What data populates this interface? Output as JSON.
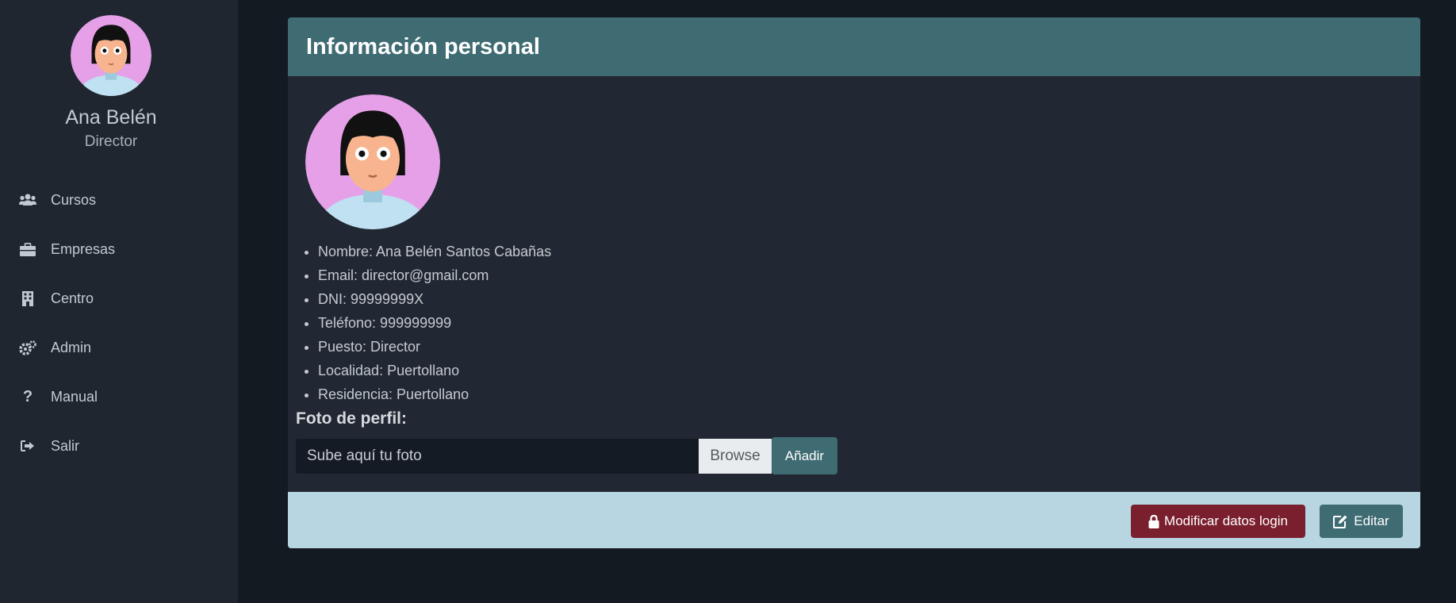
{
  "user": {
    "name": "Ana Belén",
    "role": "Director"
  },
  "sidebar": {
    "items": [
      {
        "label": "Cursos",
        "icon": "users-icon"
      },
      {
        "label": "Empresas",
        "icon": "briefcase-icon"
      },
      {
        "label": "Centro",
        "icon": "building-icon"
      },
      {
        "label": "Admin",
        "icon": "cogs-icon"
      },
      {
        "label": "Manual",
        "icon": "question-icon"
      },
      {
        "label": "Salir",
        "icon": "sign-out-icon"
      }
    ]
  },
  "card": {
    "title": "Información personal",
    "info": [
      "Nombre: Ana Belén Santos Cabañas",
      "Email: director@gmail.com",
      "DNI: 99999999X",
      "Teléfono: 999999999",
      "Puesto: Director",
      "Localidad: Puertollano",
      "Residencia: Puertollano"
    ],
    "photo_label": "Foto de perfil:",
    "file_placeholder": "Sube aquí tu foto",
    "browse_label": "Browse",
    "add_label": "Añadir",
    "login_button": "Modificar datos login",
    "edit_button": "Editar"
  },
  "colors": {
    "accent": "#3f6b73",
    "danger": "#7a1f2e",
    "footer": "#b8d6e1",
    "avatar_bg": "#e6a0e8"
  }
}
